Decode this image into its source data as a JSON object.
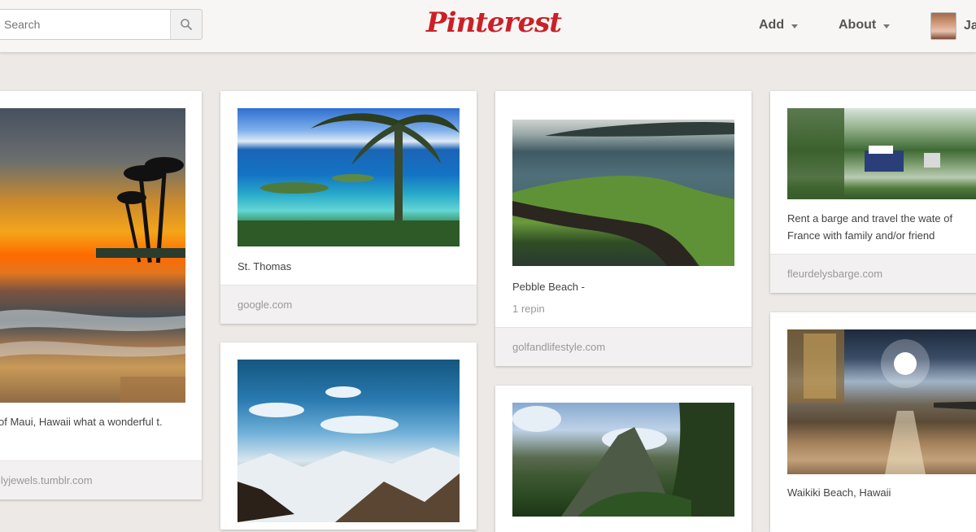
{
  "header": {
    "search": {
      "value": "",
      "placeholder": "Search"
    },
    "logo_text": "Pinterest",
    "nav": {
      "add_label": "Add",
      "about_label": "About"
    },
    "user": {
      "name": "Ja"
    },
    "brand_color": "#cb2027"
  },
  "pins": [
    {
      "description": "of Maui, Hawaii what a wonderful t.",
      "source": "ilyjewels.tumblr.com"
    },
    {
      "description": "St. Thomas",
      "source": "google.com"
    },
    {
      "description": "Pebble Beach -",
      "repins": "1 repin",
      "source": "golfandlifestyle.com"
    },
    {
      "description": "Rent a barge and travel the wate of France with family and/or friend",
      "source": "fleurdelysbarge.com"
    },
    {
      "description": "Waikiki Beach, Hawaii"
    }
  ]
}
